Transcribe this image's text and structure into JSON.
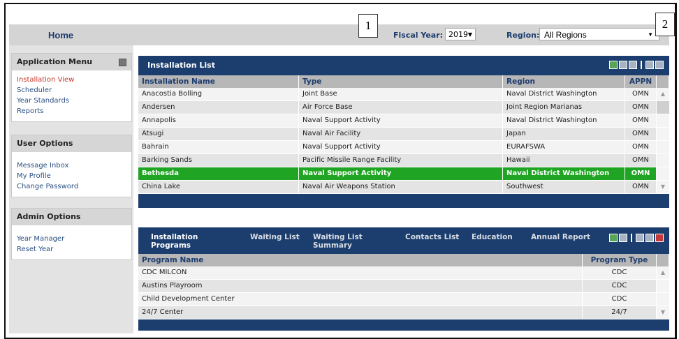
{
  "header": {
    "home": "Home",
    "fiscal_year_label": "Fiscal Year:",
    "fiscal_year_value": "2019",
    "region_label": "Region:",
    "region_value": "All Regions",
    "annotation_1": "1",
    "annotation_2": "2"
  },
  "application_menu": {
    "title": "Application Menu",
    "items": [
      "Installation View",
      "Scheduler",
      "Year Standards",
      "Reports"
    ]
  },
  "user_options": {
    "title": "User Options",
    "items": [
      "Message Inbox",
      "My Profile",
      "Change Password"
    ]
  },
  "admin_options": {
    "title": "Admin Options",
    "items": [
      "Year Manager",
      "Reset Year"
    ]
  },
  "installation_list": {
    "title": "Installation List",
    "columns": [
      "Installation Name",
      "Type",
      "Region",
      "APPN"
    ],
    "rows": [
      [
        "Anacostia Bolling",
        "Joint Base",
        "Naval District Washington",
        "OMN"
      ],
      [
        "Andersen",
        "Air Force Base",
        "Joint Region Marianas",
        "OMN"
      ],
      [
        "Annapolis",
        "Naval Support Activity",
        "Naval District Washington",
        "OMN"
      ],
      [
        "Atsugi",
        "Naval Air Facility",
        "Japan",
        "OMN"
      ],
      [
        "Bahrain",
        "Naval Support Activity",
        "EURAFSWA",
        "OMN"
      ],
      [
        "Barking Sands",
        "Pacific Missile Range Facility",
        "Hawaii",
        "OMN"
      ],
      [
        "Bethesda",
        "Naval Support Activity",
        "Naval District Washington",
        "OMN"
      ],
      [
        "China Lake",
        "Naval Air Weapons Station",
        "Southwest",
        "OMN"
      ]
    ],
    "selected_row": "Bethesda"
  },
  "programs": {
    "tabs": [
      {
        "label_1": "Installation",
        "label_2": "Programs"
      },
      {
        "label_1": "Waiting List",
        "label_2": ""
      },
      {
        "label_1": "Waiting List",
        "label_2": "Summary"
      },
      {
        "label_1": "Contacts List",
        "label_2": ""
      },
      {
        "label_1": "Education",
        "label_2": ""
      },
      {
        "label_1": "Annual Report",
        "label_2": ""
      }
    ],
    "columns": [
      "Program Name",
      "Program Type"
    ],
    "rows": [
      [
        "CDC MILCON",
        "CDC"
      ],
      [
        "Austins Playroom",
        "CDC"
      ],
      [
        "Child Development Center",
        "CDC"
      ],
      [
        "24/7 Center",
        "24/7"
      ]
    ]
  },
  "colors": {
    "navy": "#1c3e6e",
    "selected": "#1fa523",
    "link": "#2a4f82",
    "active_link": "#c9382a"
  }
}
